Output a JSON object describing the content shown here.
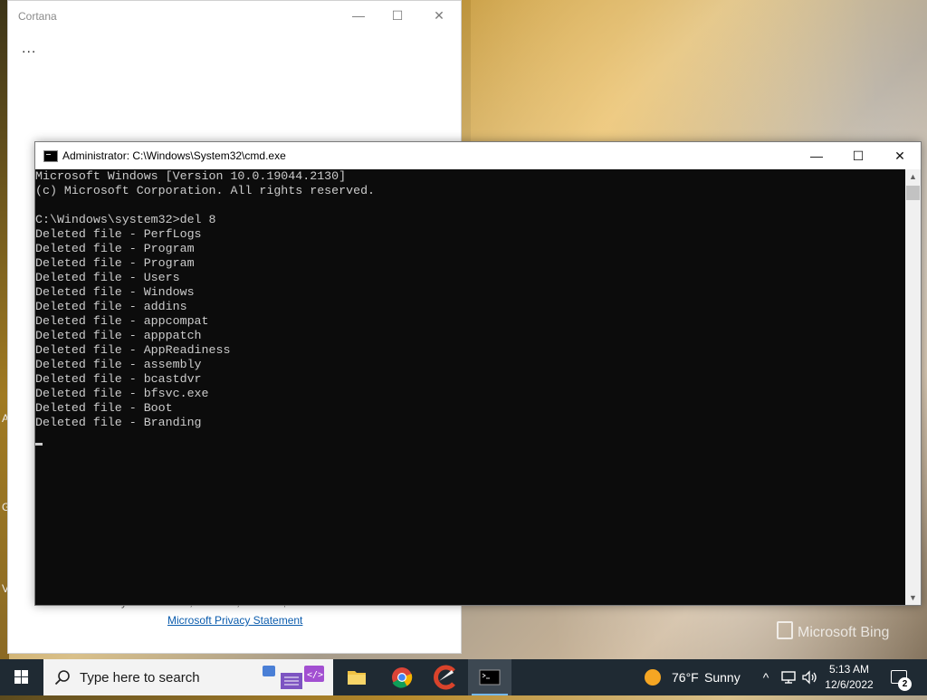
{
  "desktop": {
    "watermark": "Microsoft Bing",
    "edge_letters": [
      "A",
      "G",
      "V"
    ]
  },
  "cortana": {
    "title": "Cortana",
    "more_glyph": "...",
    "hint_text": "your searches, calendar, contacts, and location.",
    "privacy_link": "Microsoft Privacy Statement",
    "controls": {
      "minimize": "—",
      "maximize": "☐",
      "close": "✕"
    }
  },
  "cmd": {
    "title": "Administrator:  C:\\Windows\\System32\\cmd.exe",
    "controls": {
      "minimize": "—",
      "maximize": "☐",
      "close": "✕"
    },
    "lines": [
      "Microsoft Windows [Version 10.0.19044.2130]",
      "(c) Microsoft Corporation. All rights reserved.",
      "",
      "C:\\Windows\\system32>del 8",
      "Deleted file - PerfLogs",
      "Deleted file - Program",
      "Deleted file - Program",
      "Deleted file - Users",
      "Deleted file - Windows",
      "Deleted file - addins",
      "Deleted file - appcompat",
      "Deleted file - apppatch",
      "Deleted file - AppReadiness",
      "Deleted file - assembly",
      "Deleted file - bcastdvr",
      "Deleted file - bfsvc.exe",
      "Deleted file - Boot",
      "Deleted file - Branding"
    ]
  },
  "taskbar": {
    "search_placeholder": "Type here to search",
    "apps": [
      {
        "name": "file-explorer",
        "active": false
      },
      {
        "name": "chrome",
        "active": false
      },
      {
        "name": "ccleaner",
        "active": false
      },
      {
        "name": "command-prompt",
        "active": true
      }
    ],
    "weather": {
      "temp": "76°F",
      "condition": "Sunny"
    },
    "clock": {
      "time": "5:13 AM",
      "date": "12/6/2022"
    },
    "notifications": {
      "count": "2"
    },
    "colors": {
      "accent": "#76b9ed",
      "bar": "#1f2a33"
    }
  }
}
